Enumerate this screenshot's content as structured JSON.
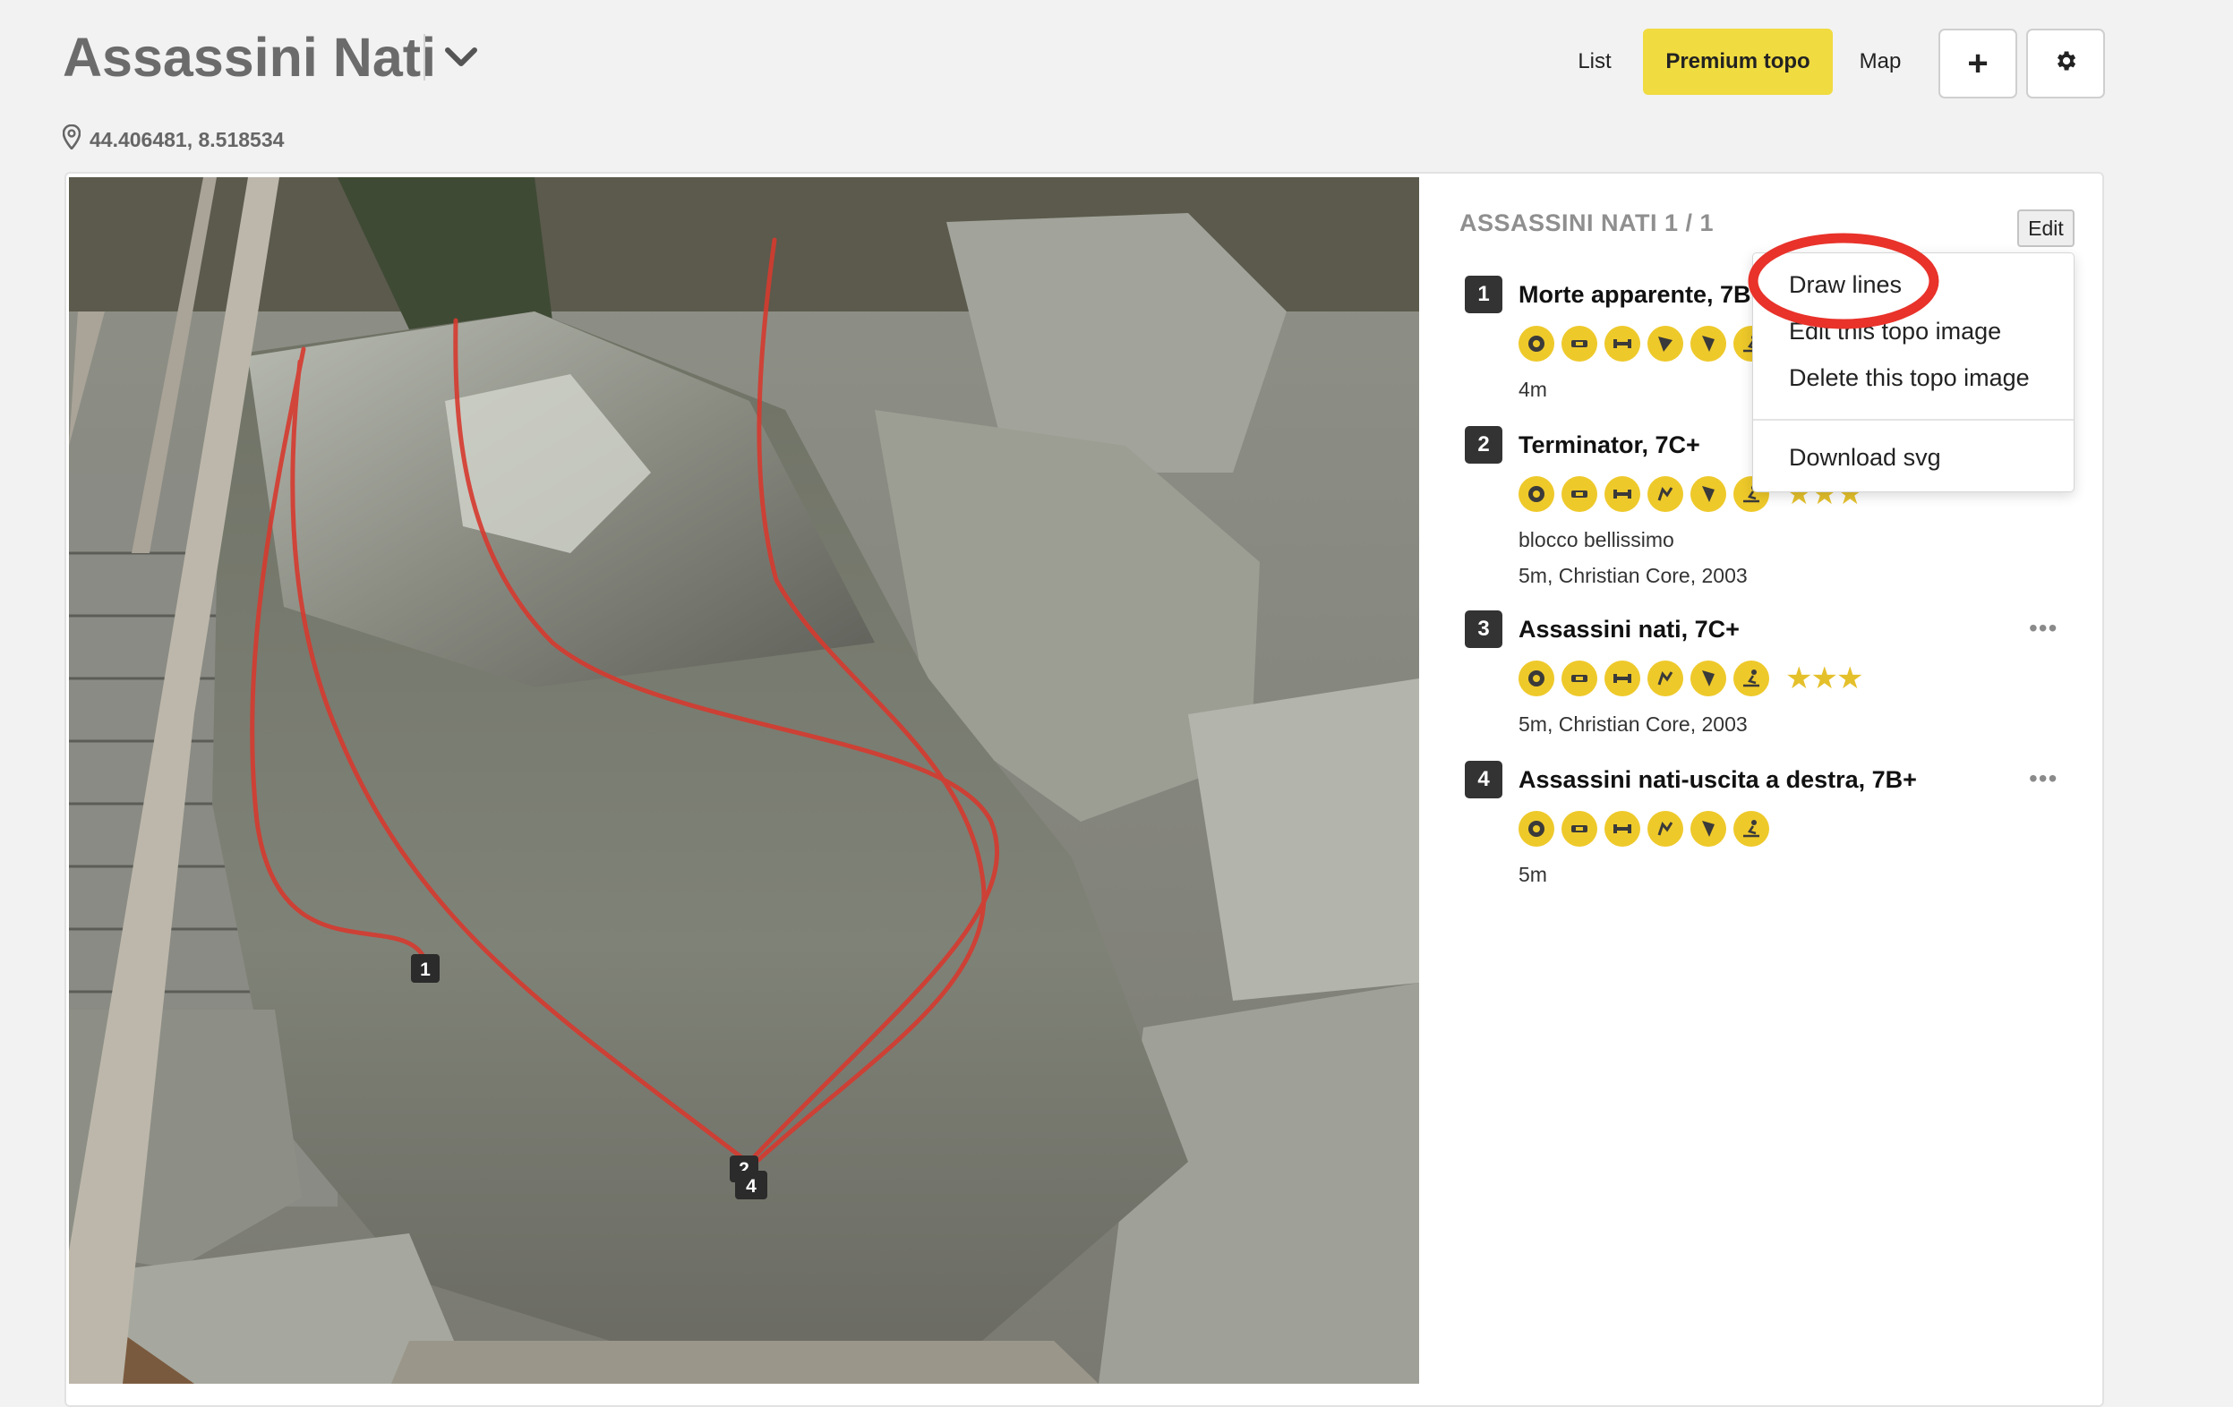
{
  "header": {
    "title": "Assassini Nati",
    "coordinates": "44.406481, 8.518534",
    "nav": {
      "list_label": "List",
      "premium_label": "Premium topo",
      "map_label": "Map",
      "add_label": "+"
    }
  },
  "panel": {
    "heading": "ASSASSINI NATI 1 / 1",
    "edit_label": "Edit",
    "problems": [
      {
        "number": "1",
        "name": "Morte apparente, 7B",
        "icons": [
          "crimp-icon",
          "sloper-icon",
          "compression-icon",
          "dyno-icon",
          "arete-icon",
          "sitstart-icon"
        ],
        "stars": "",
        "description": "",
        "details": "4m"
      },
      {
        "number": "2",
        "name": "Terminator, 7C+",
        "icons": [
          "crimp-icon",
          "sloper-icon",
          "compression-icon",
          "heel-hook-icon",
          "arete-icon",
          "sitstart-icon"
        ],
        "stars": "★★★",
        "description": "blocco bellissimo",
        "details": "5m, Christian Core, 2003"
      },
      {
        "number": "3",
        "name": "Assassini nati, 7C+",
        "icons": [
          "crimp-icon",
          "sloper-icon",
          "compression-icon",
          "heel-hook-icon",
          "arete-icon",
          "sitstart-icon"
        ],
        "stars": "★★★",
        "description": "",
        "details": "5m, Christian Core, 2003"
      },
      {
        "number": "4",
        "name": "Assassini nati-uscita a destra, 7B+",
        "icons": [
          "crimp-icon",
          "sloper-icon",
          "compression-icon",
          "heel-hook-icon",
          "arete-icon",
          "sitstart-icon"
        ],
        "stars": "",
        "description": "",
        "details": "5m"
      }
    ],
    "more_label": "•••"
  },
  "dropdown": {
    "items": [
      "Draw lines",
      "Edit this topo image",
      "Delete this topo image",
      "Download svg"
    ]
  },
  "topo": {
    "line_labels": [
      "1",
      "2",
      "4"
    ],
    "line_color": "#d63a2f"
  },
  "colors": {
    "accent": "#f0db41",
    "highlight": "#e8322a",
    "icon_fill": "#eec92a"
  }
}
